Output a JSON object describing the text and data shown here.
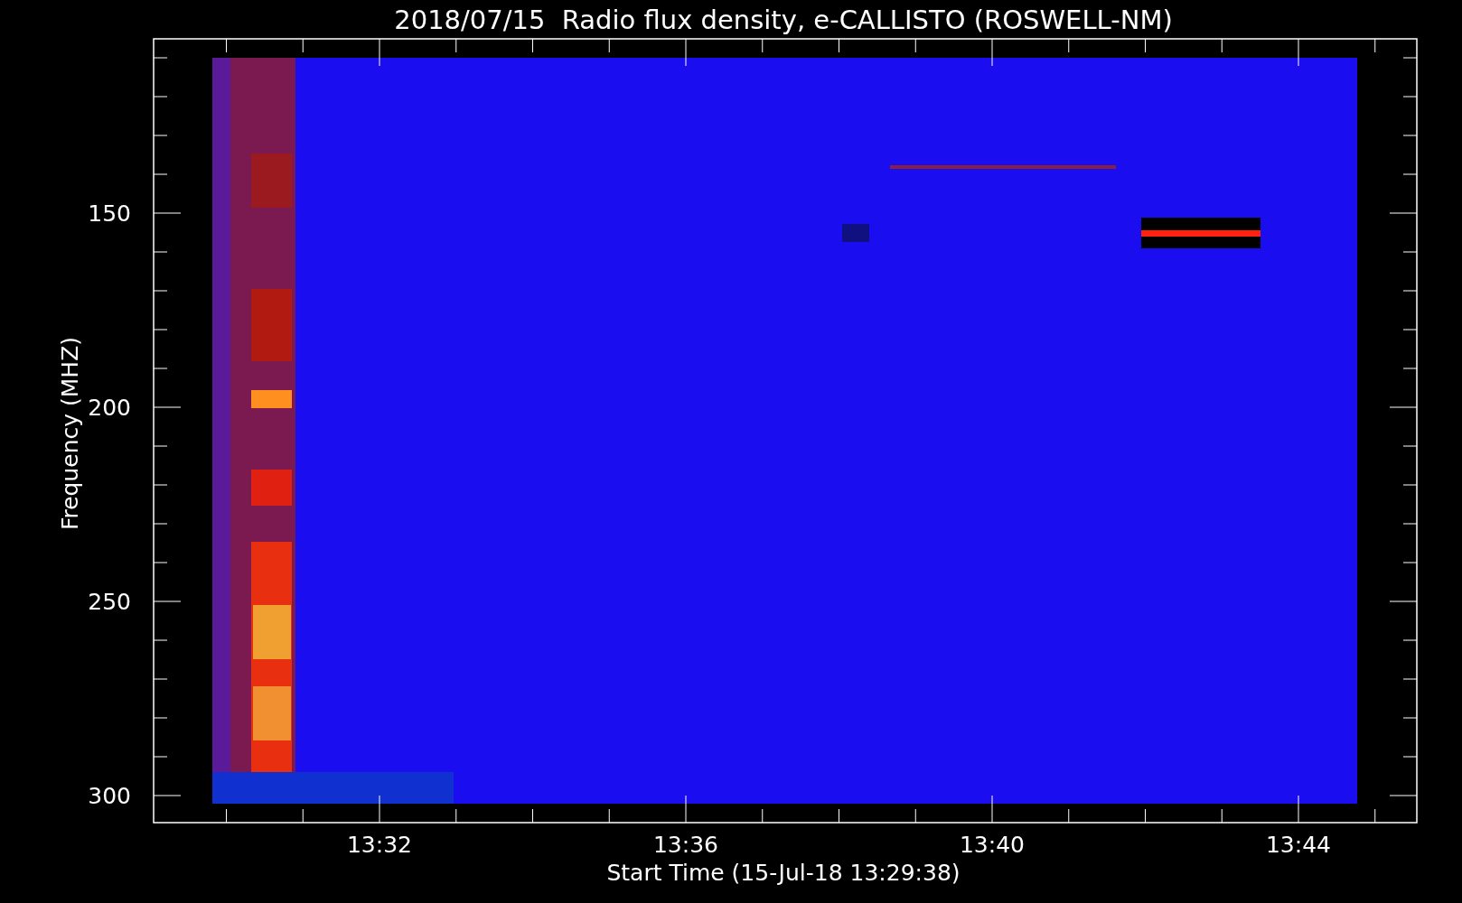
{
  "title": "2018/07/15  Radio flux density, e-CALLISTO (ROSWELL-NM)",
  "y_axis": {
    "label": "Frequency (MHZ)",
    "ticks": [
      "150",
      "200",
      "250",
      "300"
    ]
  },
  "x_axis": {
    "label": "Start Time (15-Jul-18 13:29:38)",
    "ticks": [
      "13:32",
      "13:36",
      "13:40",
      "13:44"
    ]
  }
}
